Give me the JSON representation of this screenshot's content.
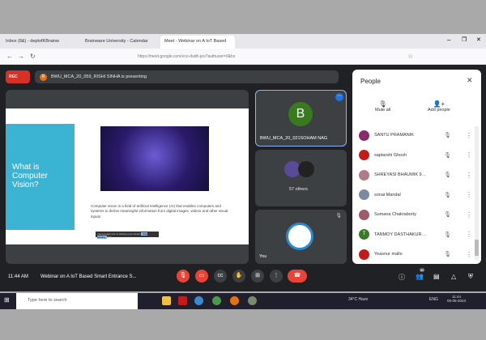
{
  "browser": {
    "tabs": [
      {
        "label": "Inbox (8&) - deptofKBrainw"
      },
      {
        "label": "Brainware University - Calendar"
      },
      {
        "label": "Meet - Webinar on A IoT Based"
      }
    ],
    "url": "https://meet.google.com/vco-dudh-jeo?authuser=0&hs"
  },
  "meet": {
    "rec_label": "REC",
    "presenter_initial": "R",
    "presenter_text": "BWU_MCA_20_059_RISHI SINHA is presenting",
    "slide": {
      "title": "What is Computer Vision?",
      "description": "Computer vision is a field of artificial intelligence (AI) that enables computers and systems to derive meaningful information from digital images, videos and other visual inputs.",
      "share_bar": "meet.google.com is sharing your screen",
      "share_button": "Stop sharing",
      "hide": "Hide"
    },
    "tiles": [
      {
        "initial": "B",
        "name": "BWU_MCA_20_021SOHAM NAG"
      },
      {
        "name": "57 others"
      },
      {
        "name": "You"
      }
    ],
    "time": "11:44 AM",
    "meeting_title": "Webinar on A IoT Based Smart Entrance S...",
    "participant_count": "60"
  },
  "people": {
    "title": "People",
    "mute_all": "Mute all",
    "add_people": "Add people",
    "list": [
      {
        "name": "SANTU PRAMANIK",
        "color": "#8a2a6a"
      },
      {
        "name": "saptarshi Ghosh",
        "color": "#c41a1a"
      },
      {
        "name": "SHREYASI BHAUMIK 9ec...",
        "color": "#b07a8a"
      },
      {
        "name": "sonai Mandal",
        "color": "#7a8aa0"
      },
      {
        "name": "Sumana Chakraborty",
        "color": "#a05a6a"
      },
      {
        "name": "TANMOY DASTHAKUR S...",
        "color": "#3a7a2a",
        "initial": "T"
      },
      {
        "name": "Yeasnur mallo",
        "color": "#c41a1a"
      }
    ]
  },
  "taskbar": {
    "search_placeholder": "Type here to search",
    "weather": "34°C Haze",
    "lang": "ENG",
    "time": "11:44",
    "date": "05-06-2023"
  }
}
